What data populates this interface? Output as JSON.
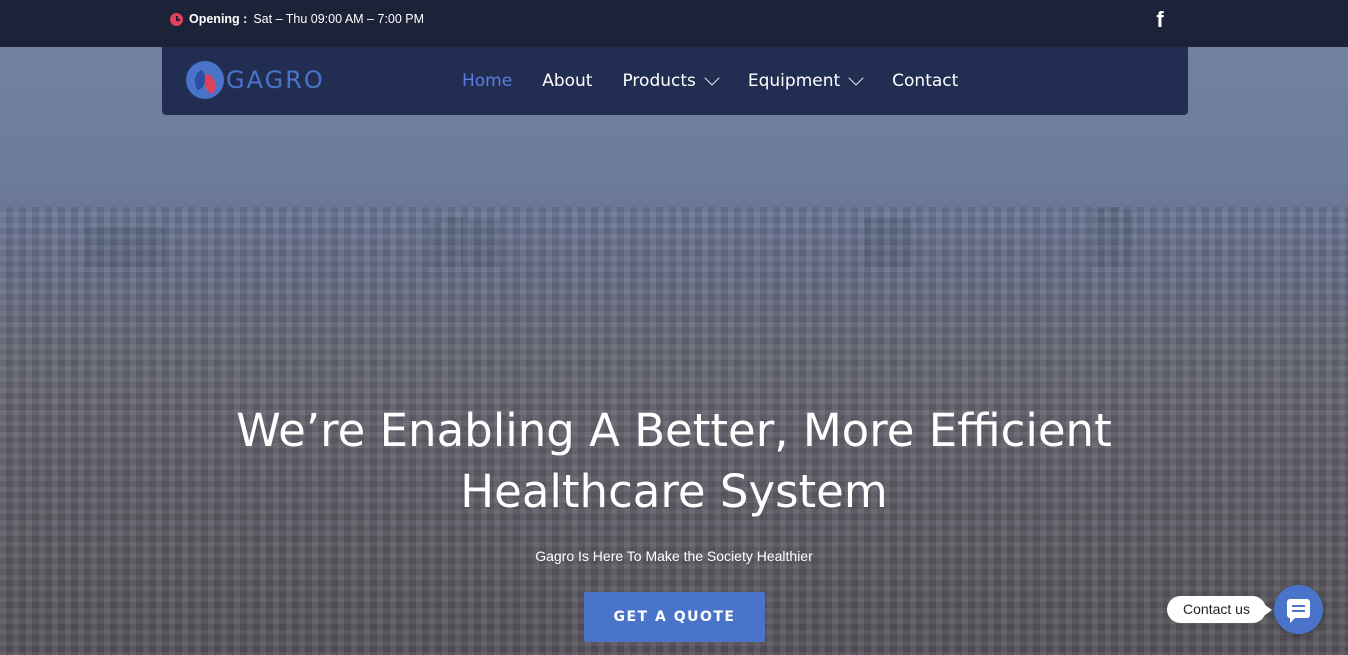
{
  "topbar": {
    "opening_label": "Opening :",
    "opening_hours": "Sat – Thu 09:00 AM – 7:00 PM",
    "facebook_glyph": "f"
  },
  "brand": {
    "logo_text": "GAGRO",
    "accent_color": "#4a74c9",
    "leaf_color": "#e0415a"
  },
  "nav": {
    "items": [
      {
        "label": "Home",
        "active": true,
        "dropdown": false
      },
      {
        "label": "About",
        "active": false,
        "dropdown": false
      },
      {
        "label": "Products",
        "active": false,
        "dropdown": true
      },
      {
        "label": "Equipment",
        "active": false,
        "dropdown": true
      },
      {
        "label": "Contact",
        "active": false,
        "dropdown": false
      }
    ]
  },
  "hero": {
    "headline_line1": "We’re Enabling A Better, More Efficient",
    "headline_line2": "Healthcare System",
    "subtitle": "Gagro Is Here To Make the Society Healthier",
    "cta_label": "GET A QUOTE"
  },
  "widget": {
    "contact_label": "Contact us"
  }
}
